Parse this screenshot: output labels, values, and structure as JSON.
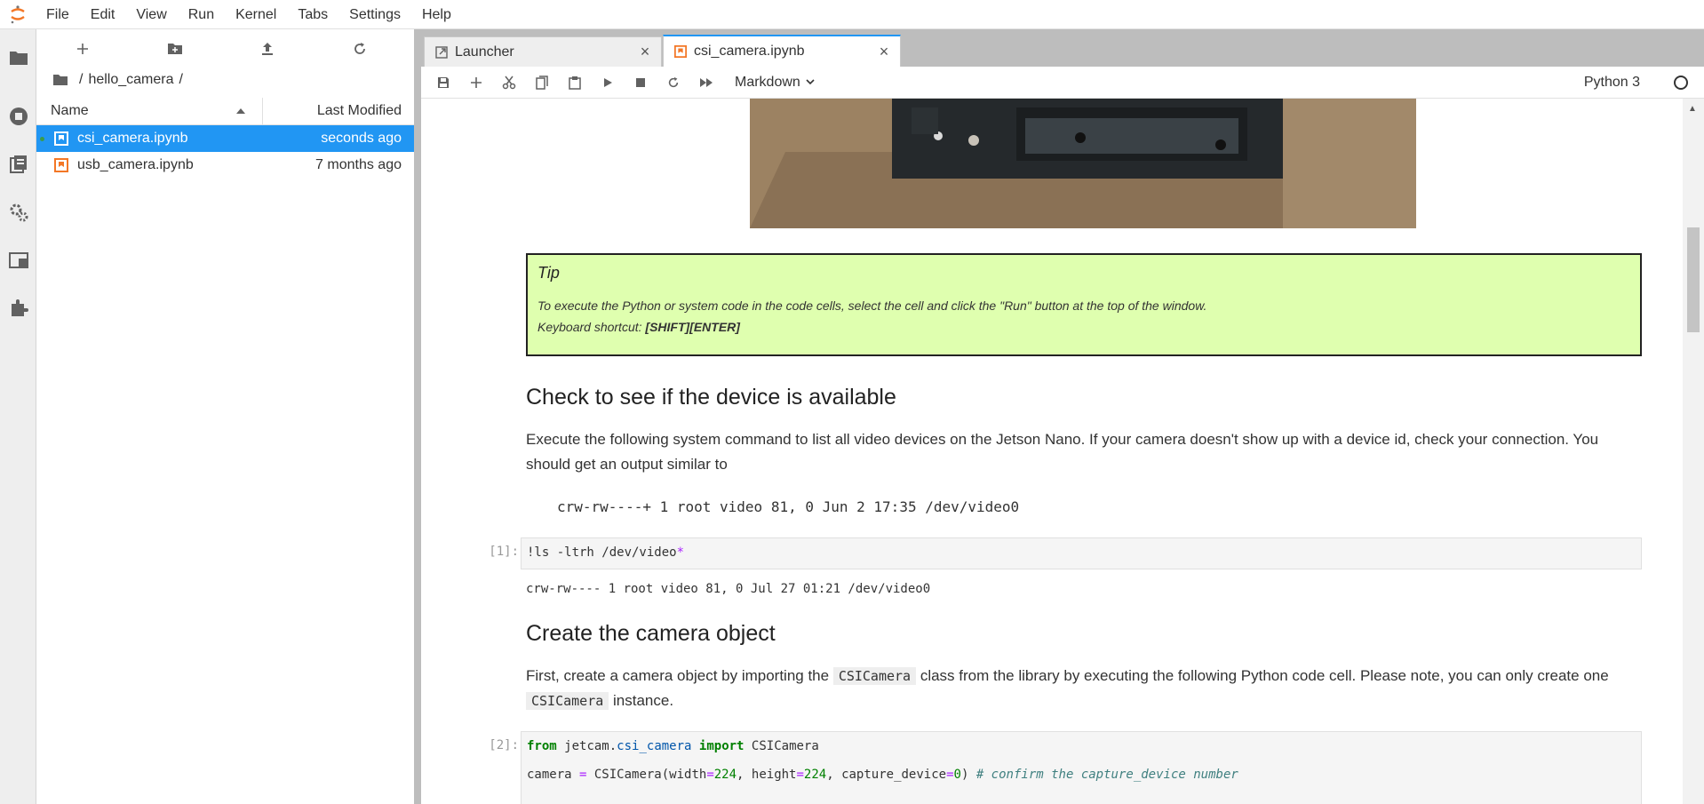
{
  "menubar": {
    "items": [
      "File",
      "Edit",
      "View",
      "Run",
      "Kernel",
      "Tabs",
      "Settings",
      "Help"
    ]
  },
  "activity_bar": {
    "icons": [
      "folder-icon",
      "running-icon",
      "commands-icon",
      "property-inspector-icon",
      "tabs-icon",
      "extensions-icon"
    ]
  },
  "file_browser": {
    "breadcrumb": {
      "root": "/",
      "folder": "hello_camera",
      "trail": "/"
    },
    "columns": {
      "name": "Name",
      "modified": "Last Modified"
    },
    "files": [
      {
        "name": "csi_camera.ipynb",
        "modified": "seconds ago",
        "selected": true
      },
      {
        "name": "usb_camera.ipynb",
        "modified": "7 months ago",
        "selected": false
      }
    ]
  },
  "tabs": [
    {
      "label": "Launcher",
      "active": false
    },
    {
      "label": "csi_camera.ipynb",
      "active": true
    }
  ],
  "notebook_toolbar": {
    "cell_type": "Markdown",
    "kernel": "Python 3"
  },
  "notebook": {
    "tip": {
      "title": "Tip",
      "line1": "To execute the Python or system code in the code cells, select the cell and click the \"Run\" button at the top of the window.",
      "line2_prefix": "Keyboard shortcut: ",
      "line2_kbd": "[SHIFT][ENTER]"
    },
    "section1": {
      "heading": "Check to see if the device is available",
      "para": "Execute the following system command to list all video devices on the Jetson Nano. If your camera doesn't show up with a device id, check your connection. You should get an output similar to",
      "pre": "crw-rw----+ 1 root video 81, 0 Jun  2 17:35 /dev/video0"
    },
    "cell1": {
      "prompt": "[1]:",
      "cmd": "!ls -ltrh /dev/video",
      "glob": "*",
      "output": "crw-rw---- 1 root video 81, 0 Jul 27 01:21 /dev/video0"
    },
    "section2": {
      "heading": "Create the camera object",
      "para_a": "First, create a camera object by importing the ",
      "code_a": "CSICamera",
      "para_b": " class from the library by executing the following Python code cell. Please note, you can only create one ",
      "code_b": "CSICamera",
      "para_c": " instance."
    },
    "cell2": {
      "prompt": "[2]:",
      "from_kw": "from",
      "module_a": "jetcam.",
      "module_b": "csi_camera",
      "import_kw": "import",
      "cls": "CSICamera",
      "assign": "camera ",
      "eq": "=",
      "call": " CSICamera(width",
      "w": "224",
      "mid": ", height",
      "h": "224",
      "mid2": ", capture_device",
      "dev": "0",
      "close": ") ",
      "comment": "# confirm the capture_device number"
    }
  }
}
